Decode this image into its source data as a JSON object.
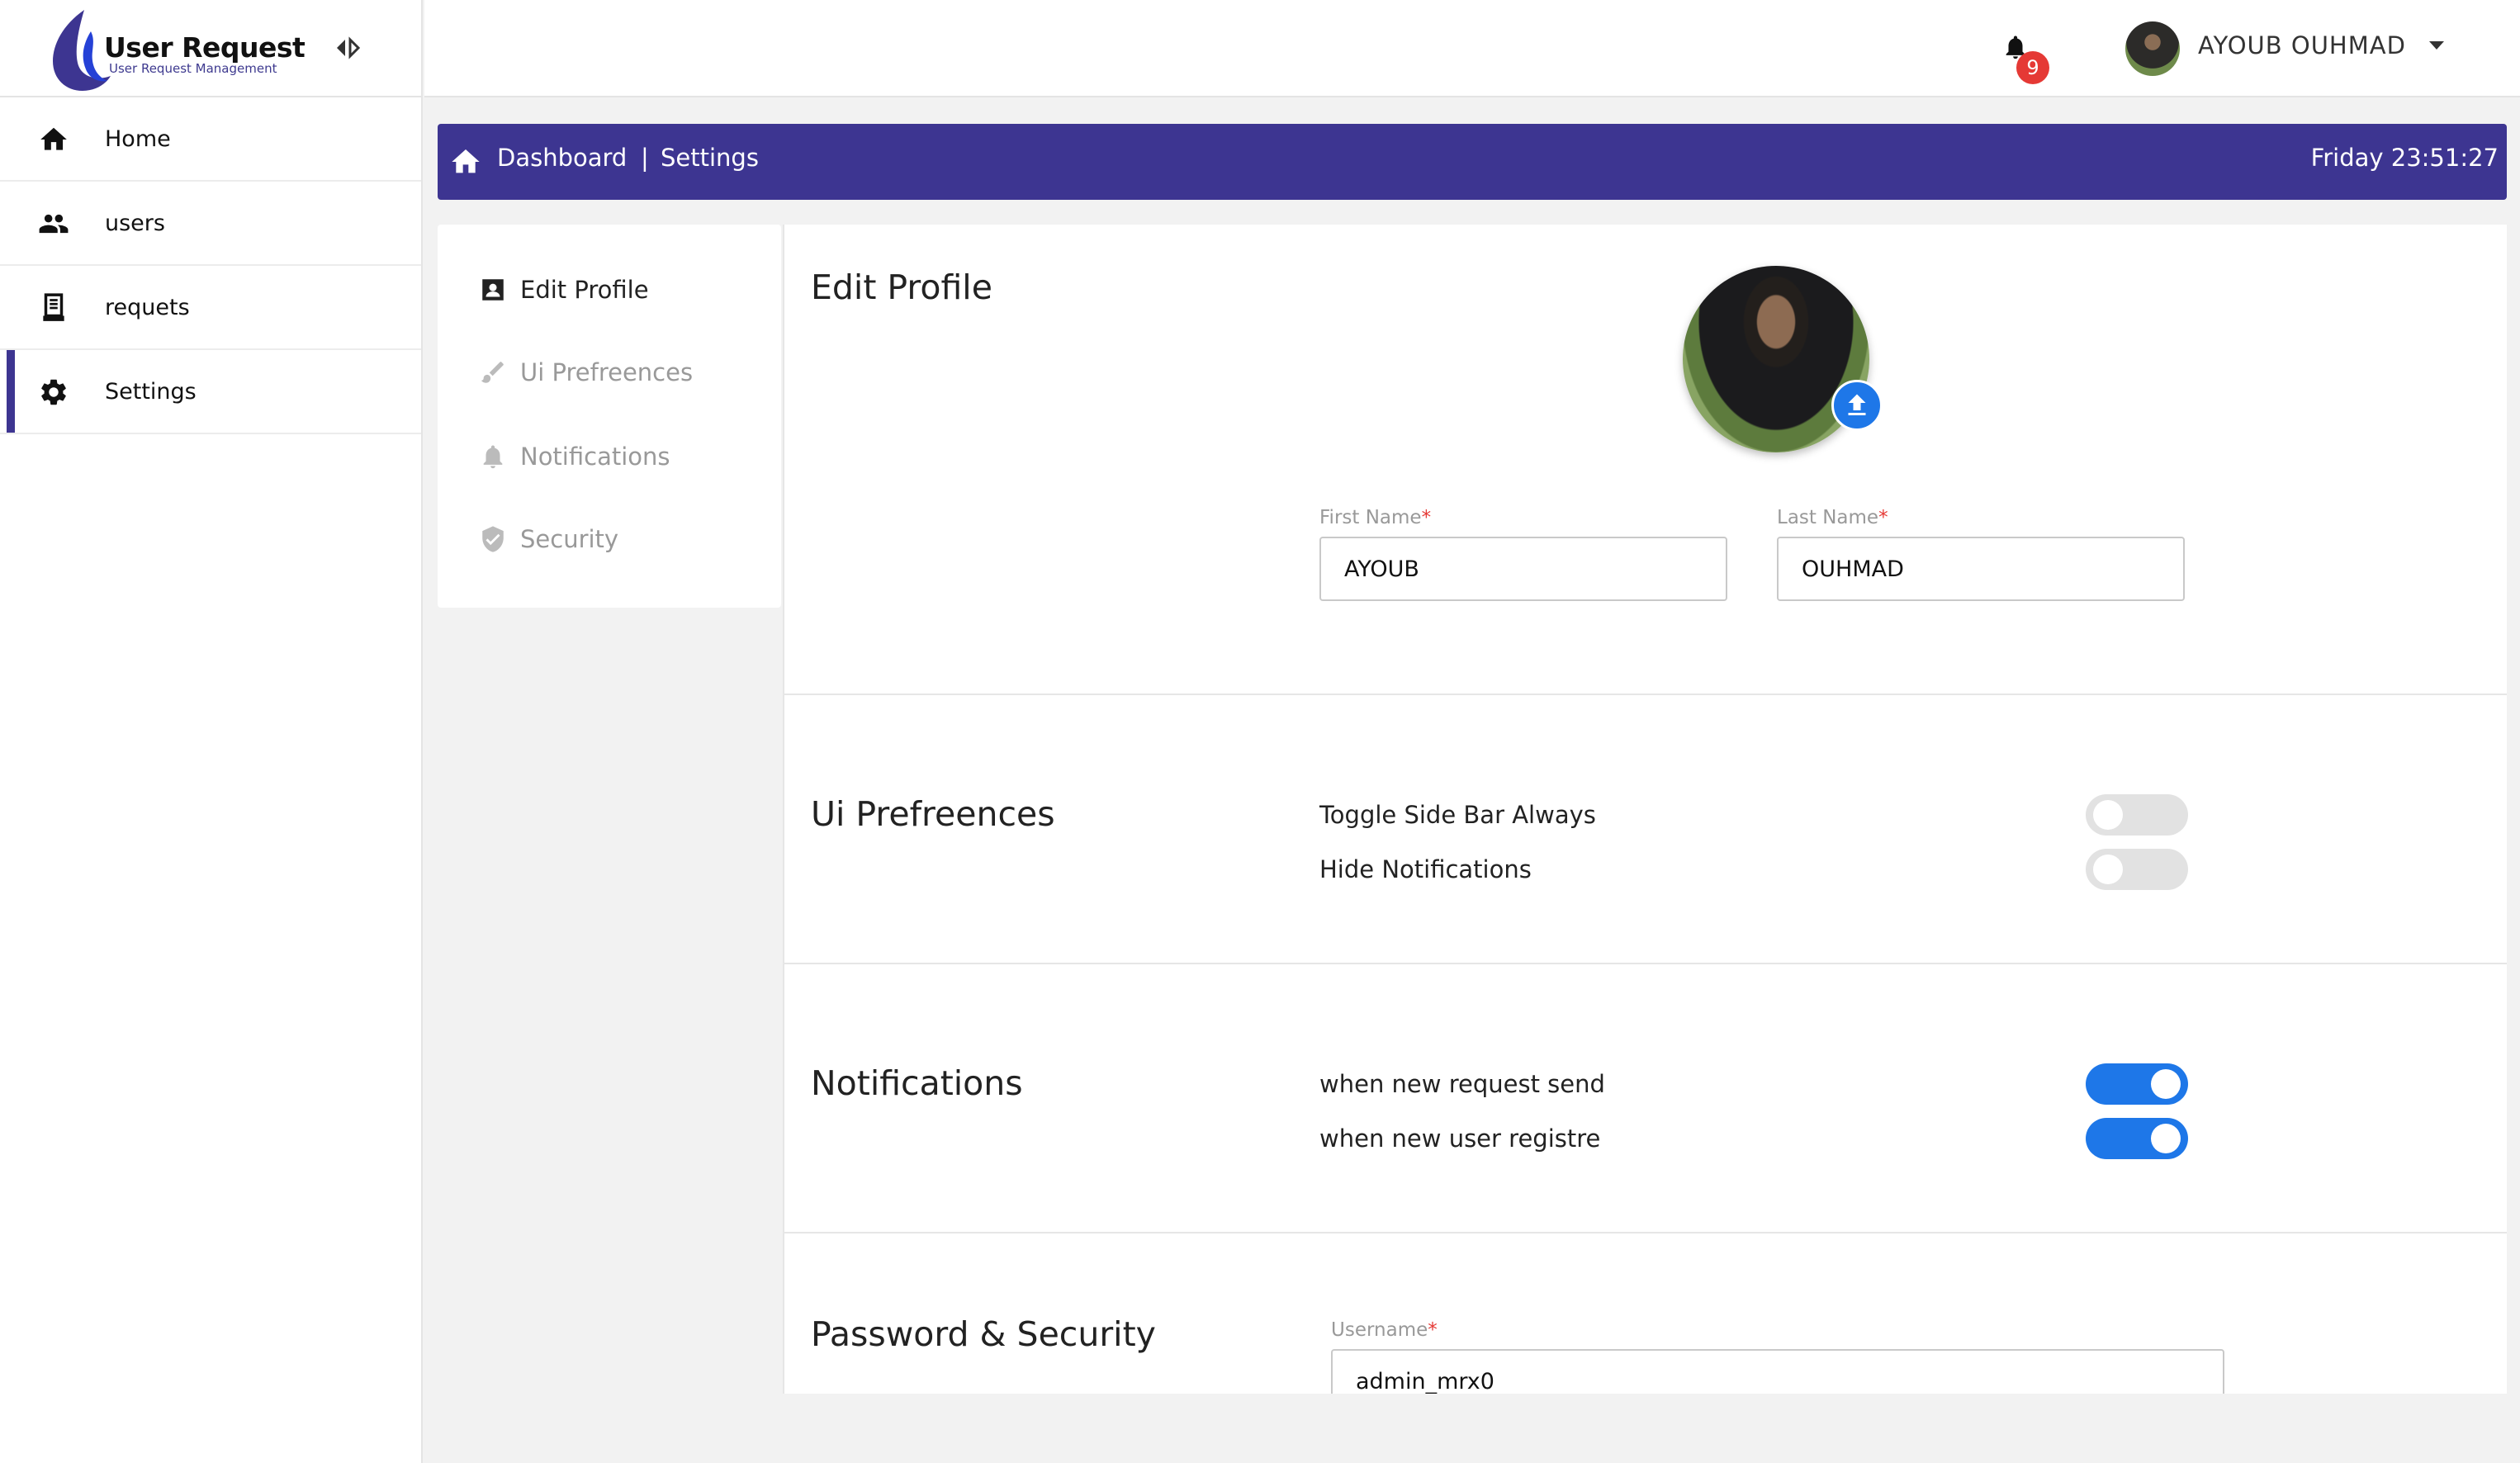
{
  "app": {
    "title": "User Request",
    "subtitle": "User Request Management"
  },
  "sidebar": {
    "items": [
      {
        "label": "Home",
        "icon": "home-icon"
      },
      {
        "label": "users",
        "icon": "users-icon"
      },
      {
        "label": "requets",
        "icon": "document-icon"
      },
      {
        "label": "Settings",
        "icon": "gear-icon",
        "active": true
      }
    ]
  },
  "topbar": {
    "notification_count": "9",
    "user_name": "AYOUB OUHMAD"
  },
  "breadcrumb": {
    "items": [
      "Dashboard",
      "Settings"
    ],
    "separator": "|",
    "clock": "Friday 23:51:27"
  },
  "settings_menu": {
    "items": [
      {
        "label": "Edit Profile",
        "icon": "profile-card-icon",
        "active": true
      },
      {
        "label": "Ui Prefreences",
        "icon": "brush-icon"
      },
      {
        "label": "Notifications",
        "icon": "bell-icon"
      },
      {
        "label": "Security",
        "icon": "shield-icon"
      }
    ]
  },
  "edit_profile": {
    "title": "Edit Profile",
    "first_name_label": "First Name",
    "first_name_value": "AYOUB",
    "last_name_label": "Last Name",
    "last_name_value": "OUHMAD",
    "required_mark": "*"
  },
  "ui_preferences": {
    "title": "Ui Prefreences",
    "options": [
      {
        "label": "Toggle Side Bar Always",
        "on": false
      },
      {
        "label": "Hide Notifications",
        "on": false
      }
    ]
  },
  "notifications": {
    "title": "Notifications",
    "options": [
      {
        "label": "when new request send",
        "on": true
      },
      {
        "label": "when new user registre",
        "on": true
      }
    ]
  },
  "security": {
    "title": "Password & Security",
    "username_label": "Username",
    "username_value": "admin_mrx0"
  },
  "colors": {
    "brand": "#3d3591",
    "accent": "#1e77e8",
    "badge": "#e53935"
  }
}
